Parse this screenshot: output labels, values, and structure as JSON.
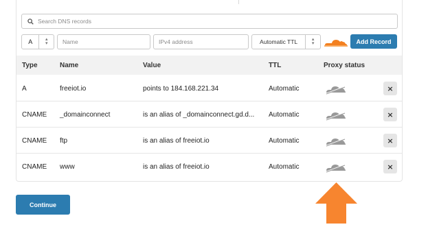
{
  "search": {
    "placeholder": "Search DNS records",
    "icon": "search-icon"
  },
  "form": {
    "type_value": "A",
    "name_placeholder": "Name",
    "value_placeholder": "IPv4 address",
    "ttl_value": "Automatic TTL",
    "add_label": "Add Record",
    "proxy_icon": "orange-cloud-icon"
  },
  "table": {
    "headers": {
      "type": "Type",
      "name": "Name",
      "value": "Value",
      "ttl": "TTL",
      "proxy": "Proxy status"
    },
    "rows": [
      {
        "type": "A",
        "name": "freeiot.io",
        "value": "points to 184.168.221.34",
        "ttl": "Automatic"
      },
      {
        "type": "CNAME",
        "name": "_domainconnect",
        "value": "is an alias of _domainconnect.gd.d...",
        "ttl": "Automatic"
      },
      {
        "type": "CNAME",
        "name": "ftp",
        "value": "is an alias of freeiot.io",
        "ttl": "Automatic"
      },
      {
        "type": "CNAME",
        "name": "www",
        "value": "is an alias of freeiot.io",
        "ttl": "Automatic"
      }
    ],
    "delete_label": "×",
    "proxy_icon": "grey-cloud-icon"
  },
  "continue_label": "Continue",
  "annotation": {
    "icon": "orange-up-arrow-icon",
    "color": "#f7852f"
  },
  "colors": {
    "accent": "#2c7cb0",
    "cloud_orange": "#f38020",
    "cloud_grey": "#999999"
  }
}
